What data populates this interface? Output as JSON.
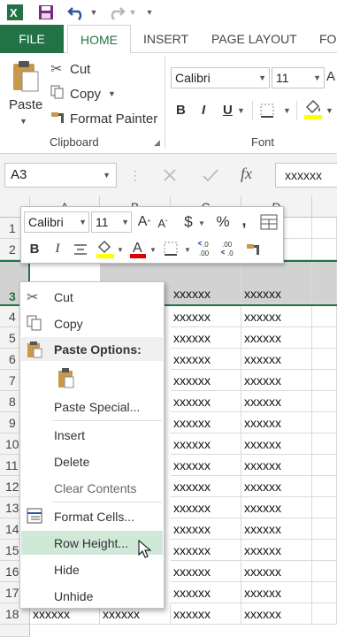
{
  "title_bar": {
    "app_icon": "excel-icon",
    "save": "save-icon",
    "undo": "undo-icon",
    "redo": "redo-icon",
    "customize": "qat-dropdown-icon"
  },
  "tabs": {
    "file": "FILE",
    "home": "HOME",
    "insert": "INSERT",
    "page_layout": "PAGE LAYOUT",
    "formulas": "FO"
  },
  "ribbon": {
    "paste": "Paste",
    "cut": "Cut",
    "copy": "Copy",
    "format_painter": "Format Painter",
    "clipboard_label": "Clipboard",
    "font_name": "Calibri",
    "font_size": "11",
    "bold": "B",
    "italic": "I",
    "underline": "U",
    "font_label": "Font"
  },
  "formula_bar": {
    "name_box": "A3",
    "fx": "fx",
    "value": "xxxxxx"
  },
  "grid": {
    "columns": [
      "A",
      "B",
      "C",
      "D"
    ],
    "rows": [
      "1",
      "2",
      "3",
      "4",
      "5",
      "6",
      "7",
      "8",
      "9",
      "10",
      "11",
      "12",
      "13",
      "14",
      "15",
      "16",
      "17",
      "18"
    ],
    "cell_text": "xxxxxx"
  },
  "mini_toolbar": {
    "font_name": "Calibri",
    "font_size": "11",
    "bold": "B",
    "italic": "I",
    "currency": "$",
    "percent": "%",
    "comma": ","
  },
  "context_menu": {
    "cut": "Cut",
    "copy": "Copy",
    "paste_options": "Paste Options:",
    "paste_special": "Paste Special...",
    "insert": "Insert",
    "delete": "Delete",
    "clear_contents": "Clear Contents",
    "format_cells": "Format Cells...",
    "row_height": "Row Height...",
    "hide": "Hide",
    "unhide": "Unhide"
  },
  "colors": {
    "accent": "#217346",
    "highlight": "#cfe8d8",
    "selection": "#d2d2d2"
  }
}
